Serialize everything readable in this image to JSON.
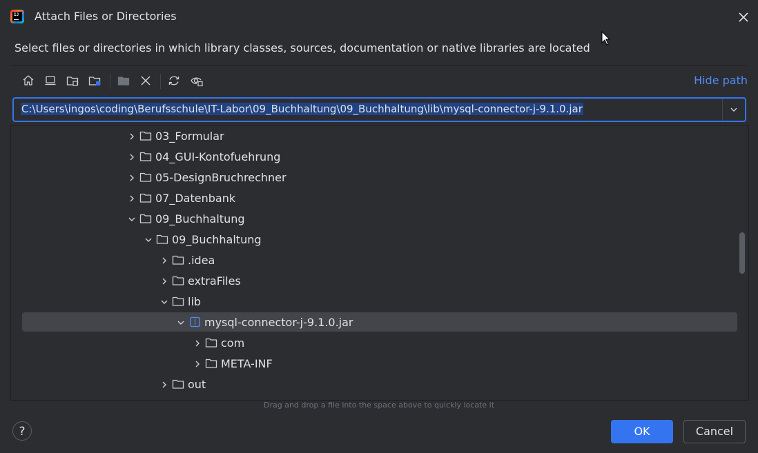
{
  "window": {
    "title": "Attach Files or Directories",
    "description": "Select files or directories in which library classes, sources, documentation or native libraries are located"
  },
  "toolbar": {
    "icons": [
      "home-icon",
      "desktop-icon",
      "project-folder-icon",
      "module-folder-icon",
      "new-folder-icon",
      "delete-icon",
      "refresh-icon",
      "show-hidden-icon"
    ],
    "hide_path_label": "Hide path"
  },
  "path": {
    "value": "C:\\Users\\ingos\\coding\\Berufsschule\\IT-Labor\\09_Buchhaltung\\09_Buchhaltung\\lib\\mysql-connector-j-9.1.0.jar"
  },
  "tree": {
    "rows": [
      {
        "label": "03_Formular",
        "expanded": false,
        "type": "folder"
      },
      {
        "label": "04_GUI-Kontofuehrung",
        "expanded": false,
        "type": "folder"
      },
      {
        "label": "05-DesignBruchrechner",
        "expanded": false,
        "type": "folder"
      },
      {
        "label": "07_Datenbank",
        "expanded": false,
        "type": "folder"
      },
      {
        "label": "09_Buchhaltung",
        "expanded": true,
        "type": "folder"
      },
      {
        "label": "09_Buchhaltung",
        "expanded": true,
        "type": "folder"
      },
      {
        "label": ".idea",
        "expanded": false,
        "type": "folder"
      },
      {
        "label": "extraFiles",
        "expanded": false,
        "type": "folder"
      },
      {
        "label": "lib",
        "expanded": true,
        "type": "folder"
      },
      {
        "label": "mysql-connector-j-9.1.0.jar",
        "expanded": true,
        "type": "jar",
        "selected": true
      },
      {
        "label": "com",
        "expanded": false,
        "type": "folder"
      },
      {
        "label": "META-INF",
        "expanded": false,
        "type": "folder"
      },
      {
        "label": "out",
        "expanded": false,
        "type": "folder"
      }
    ]
  },
  "hint": "Drag and drop a file into the space above to quickly locate it",
  "buttons": {
    "help": "?",
    "ok": "OK",
    "cancel": "Cancel"
  },
  "colors": {
    "background": "#2b2d30",
    "accent": "#3574f0",
    "link": "#548af7",
    "selection": "#43454a"
  }
}
